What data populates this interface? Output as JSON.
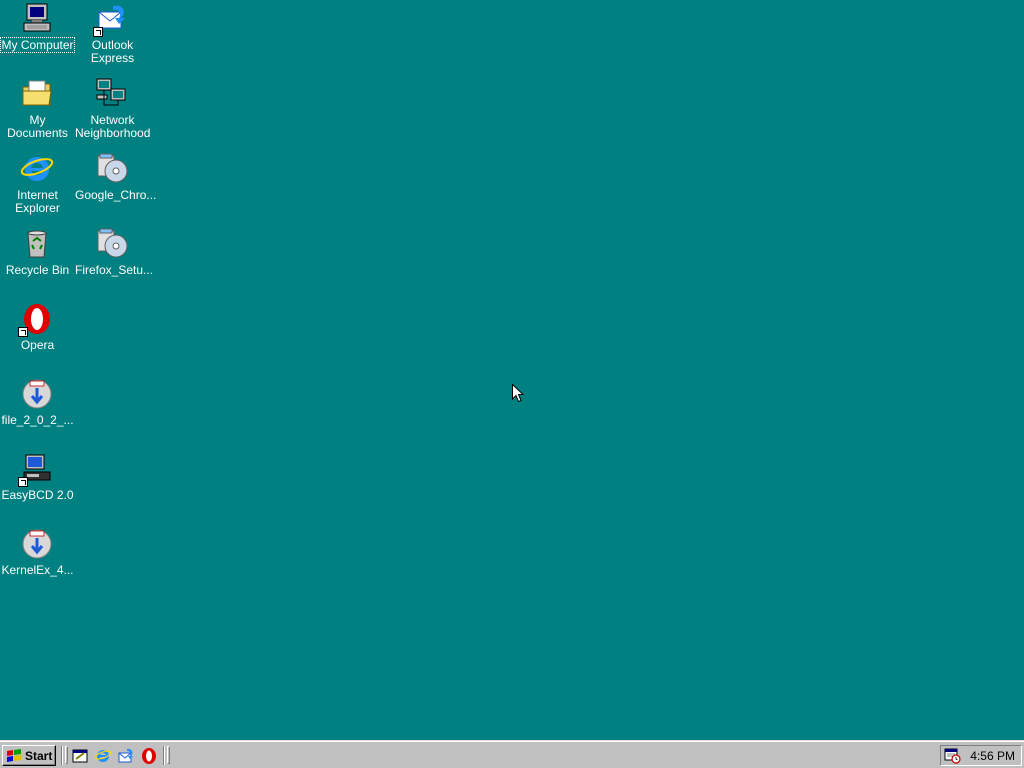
{
  "desktop": {
    "background": "#008080",
    "icons": [
      {
        "label": "My Computer",
        "icon": "my-computer-icon"
      },
      {
        "label": "Outlook\nExpress",
        "icon": "outlook-express-icon"
      },
      {
        "label": "My Documents",
        "icon": "my-documents-icon"
      },
      {
        "label": "Network\nNeighborhood",
        "icon": "network-neighborhood-icon"
      },
      {
        "label": "Internet\nExplorer",
        "icon": "internet-explorer-icon"
      },
      {
        "label": "Google_Chro...",
        "icon": "installer-cd-icon"
      },
      {
        "label": "Recycle Bin",
        "icon": "recycle-bin-icon"
      },
      {
        "label": "Firefox_Setu...",
        "icon": "installer-cd-icon"
      },
      {
        "label": "Opera",
        "icon": "opera-icon"
      },
      {
        "label": "file_2_0_2_...",
        "icon": "setup-download-icon"
      },
      {
        "label": "EasyBCD 2.0",
        "icon": "easybcd-icon"
      },
      {
        "label": "KernelEx_4...",
        "icon": "setup-download-icon"
      }
    ]
  },
  "taskbar": {
    "start_label": "Start",
    "quick_launch": [
      "show-desktop-icon",
      "internet-explorer-icon",
      "outlook-express-icon",
      "opera-icon"
    ],
    "tray_icon": "task-scheduler-icon",
    "clock": "4:56 PM"
  }
}
